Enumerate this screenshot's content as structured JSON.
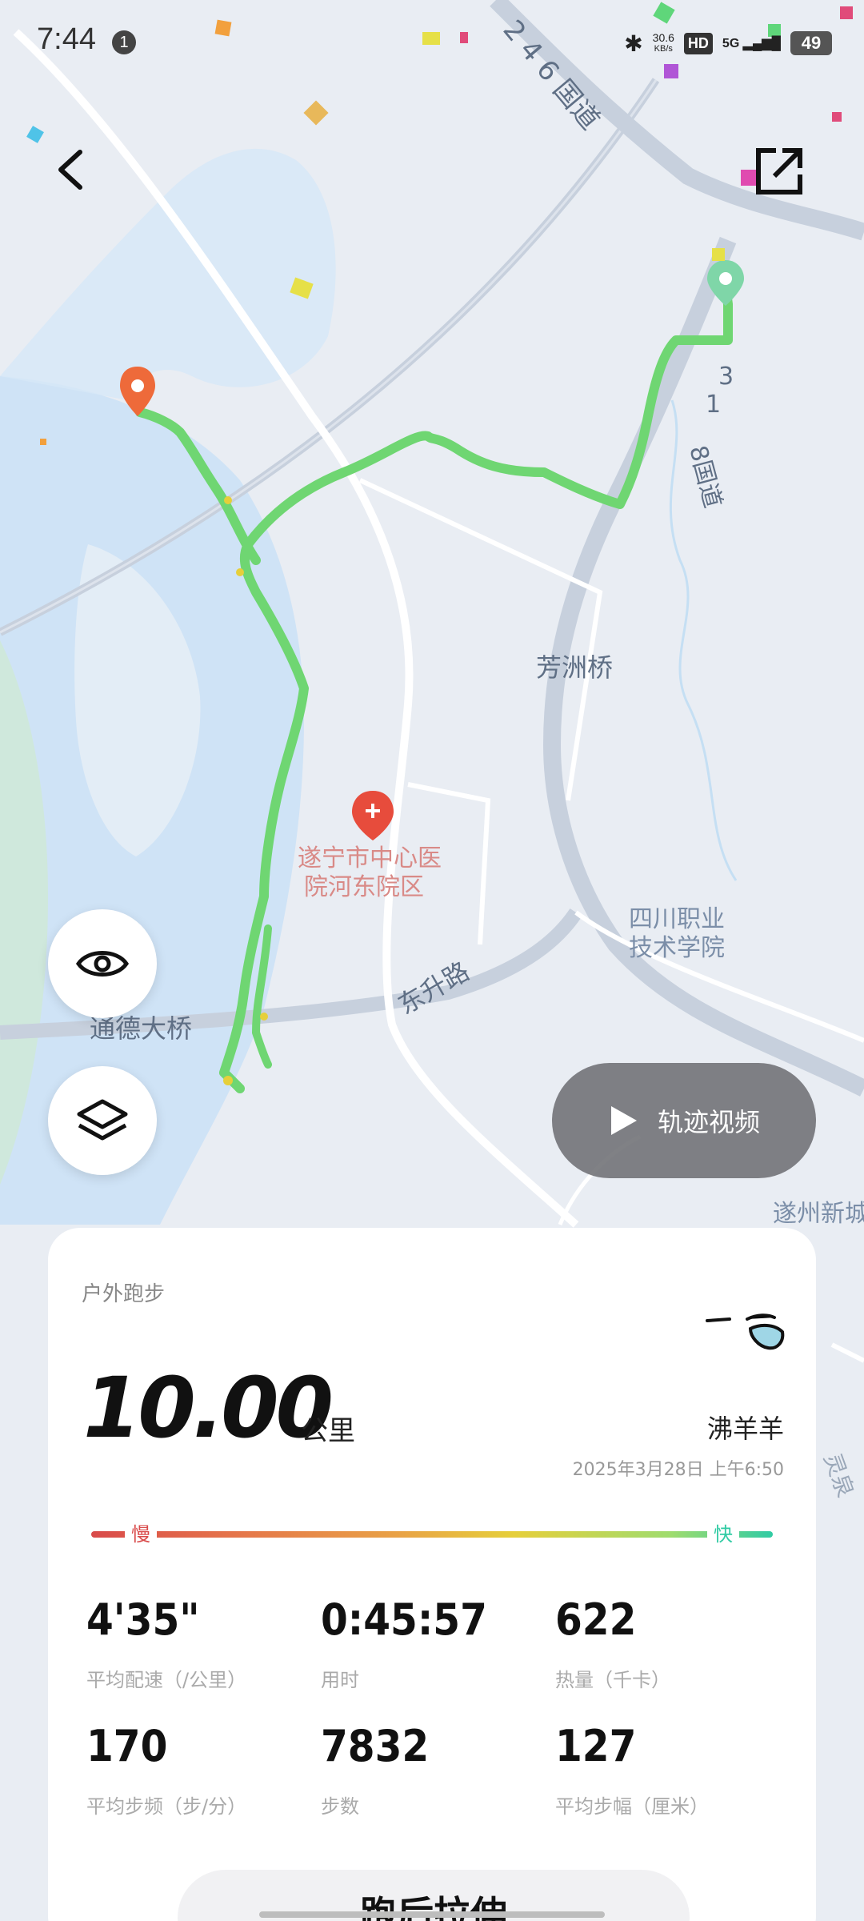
{
  "status": {
    "time": "7:44",
    "notification_count": "1",
    "net_speed_value": "30.6",
    "net_speed_unit": "KB/s",
    "hd": "HD",
    "network": "5G",
    "battery": "49"
  },
  "map": {
    "labels": {
      "road_246": "2 4 6 国道",
      "road_318_a": "3",
      "road_318_b": "1",
      "road_318_c": "8国道",
      "fangzhou_bridge": "芳洲桥",
      "hospital_line1": "遂宁市中心医",
      "hospital_line2": "院河东院区",
      "college_line1": "四川职业",
      "college_line2": "技术学院",
      "dongsheng_road": "东升路",
      "tongde_bridge": "通德大桥",
      "suizhou": "遂州新城",
      "lingquan": "灵泉"
    }
  },
  "controls": {
    "video_label": "轨迹视频"
  },
  "card": {
    "activity_type": "户外跑步",
    "distance_value": "10.00",
    "distance_unit": "公里",
    "user_name": "沸羊羊",
    "date": "2025年3月28日 上午6:50",
    "slow_label": "慢",
    "fast_label": "快",
    "stats": [
      {
        "value": "4'35\"",
        "label": "平均配速（/公里）"
      },
      {
        "value": "0:45:57",
        "label": "用时"
      },
      {
        "value": "622",
        "label": "热量（千卡）"
      },
      {
        "value": "170",
        "label": "平均步频（步/分）"
      },
      {
        "value": "7832",
        "label": "步数"
      },
      {
        "value": "127",
        "label": "平均步幅（厘米）"
      }
    ]
  },
  "bottom": {
    "title": "跑后拉伸"
  },
  "colors": {
    "route": "#6fd672",
    "water": "#cfe3f6",
    "start_pin": "#7fd6a8",
    "end_pin": "#ee6a3a",
    "hospital_pin": "#e74c3c"
  }
}
